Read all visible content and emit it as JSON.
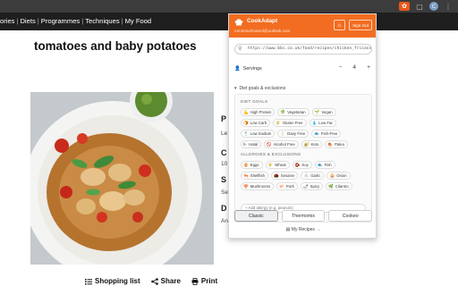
{
  "browser": {
    "extension_badge": "C",
    "avatar_letter": "C"
  },
  "site_nav": {
    "items": [
      "ories",
      "Diets",
      "Programmes",
      "Techniques",
      "My Food"
    ]
  },
  "article": {
    "title": "tomatoes and baby potatoes",
    "right_col": [
      "P",
      "Le",
      "C",
      "10",
      "S",
      "Se",
      "D",
      "An"
    ],
    "actions": {
      "shopping_list": "Shopping list",
      "share": "Share",
      "print": "Print"
    }
  },
  "popup": {
    "brand_name": "CookAdapt",
    "email": "mmmrachnamel@outlook.com",
    "sign_out": "Sign Out",
    "url": "https://www.bbc.co.uk/food/recipes/chicken_fricasse",
    "servings_label": "Servings",
    "servings_value": "4",
    "diet_toggle": "Diet goals & exclusions",
    "diet_goals_label": "DIET GOALS",
    "diet_goals": [
      [
        "High Protein",
        "Vegetarian",
        "Vegan"
      ],
      [
        "Low Carb",
        "Gluten Free",
        "Low Fat"
      ],
      [
        "Low Sodium",
        "Dairy Free",
        "Fish-Free"
      ],
      [
        "Halal",
        "Alcohol Free",
        "Keto",
        "Paleo"
      ]
    ],
    "allergies_label": "ALLERGIES & EXCLUSIONS",
    "allergies": [
      [
        "Eggs",
        "Wheat",
        "Soy",
        "Fish"
      ],
      [
        "Shellfish",
        "Sesame",
        "Garlic",
        "Onion"
      ],
      [
        "Mushrooms",
        "Pork",
        "Spicy",
        "Cilantro"
      ]
    ],
    "add_allergy_placeholder": "Add allergy (e.g. peanuts)",
    "modes": [
      "Classic",
      "Thermomix",
      "Cookeo"
    ],
    "my_recipes": "My Recipes"
  },
  "colors": {
    "accent": "#f26d21",
    "nav_bg": "#1f1f1f"
  }
}
